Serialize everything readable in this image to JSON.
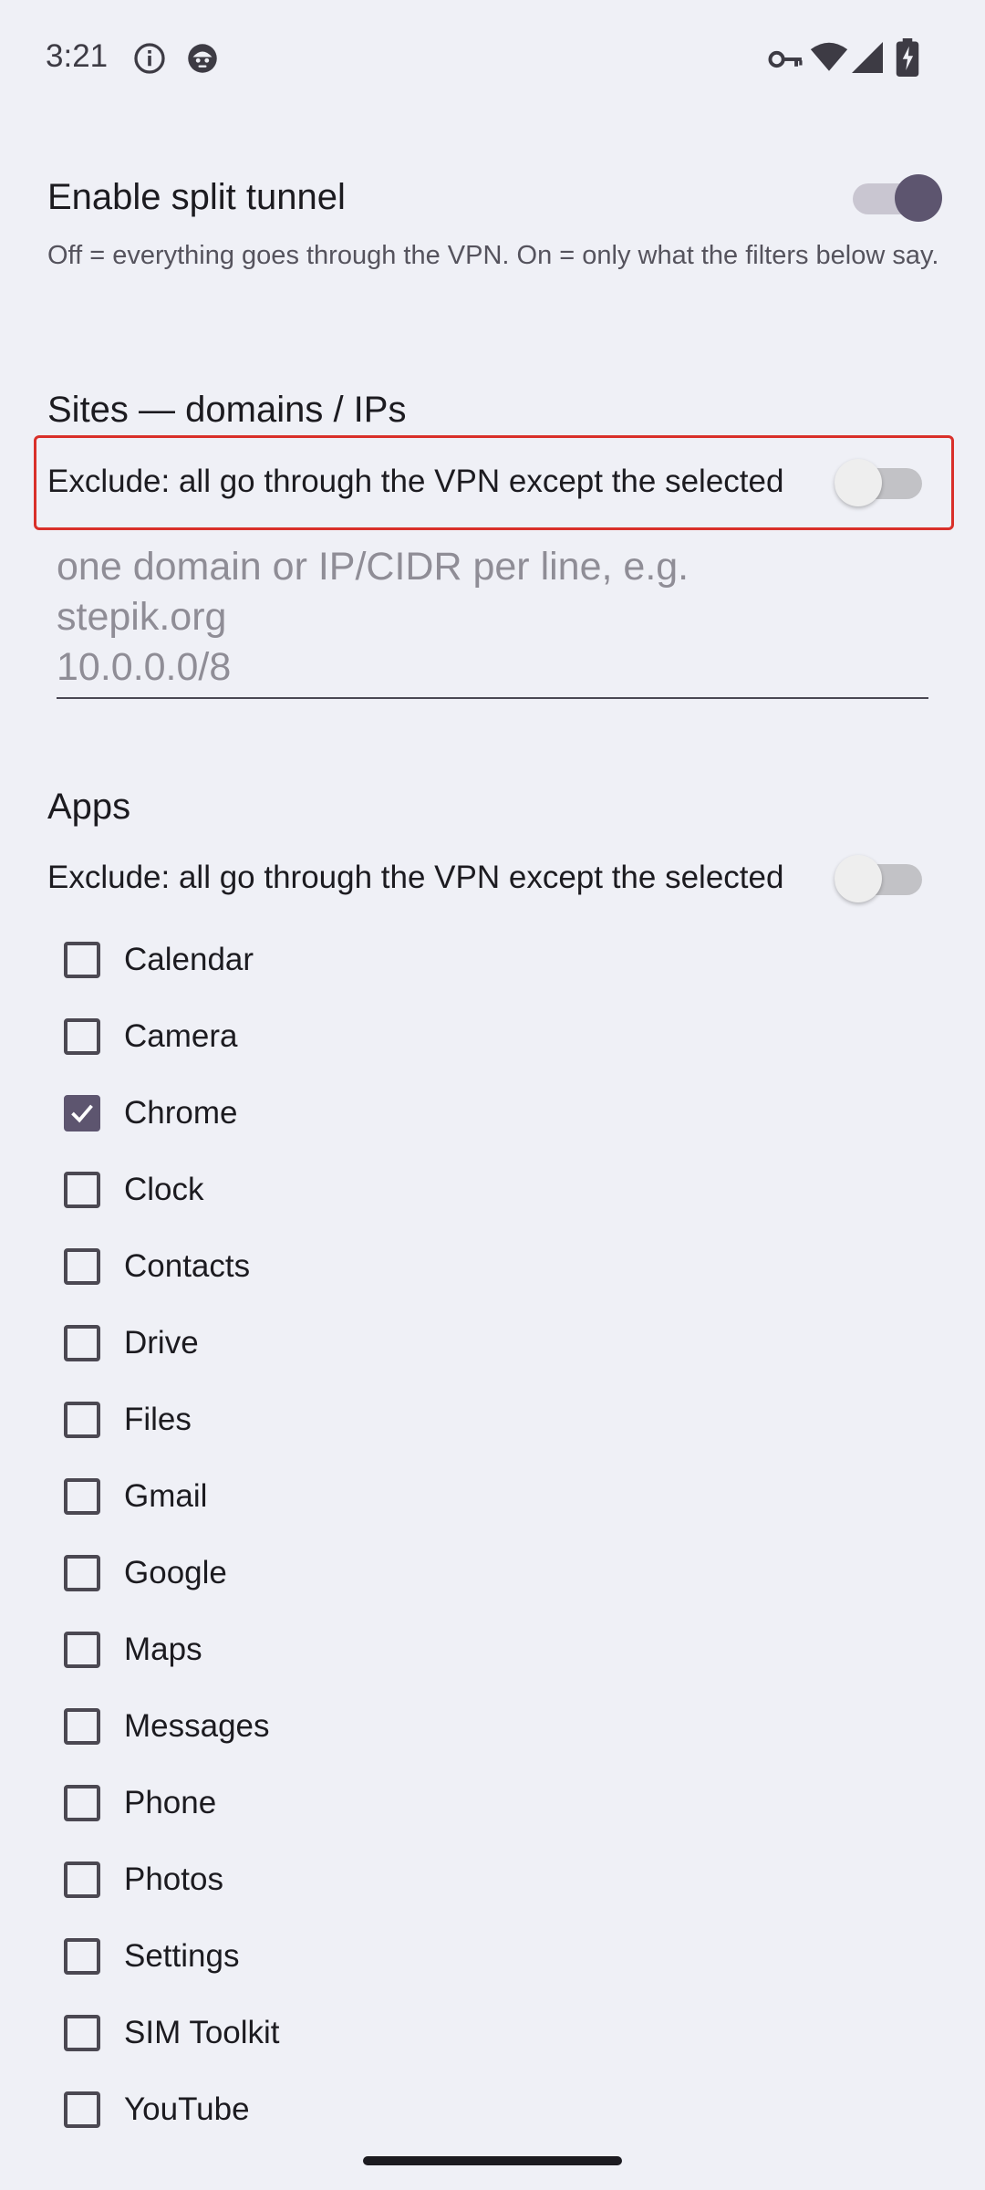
{
  "status_bar": {
    "time": "3:21",
    "icons": [
      "info-icon",
      "robot-icon",
      "vpn-key-icon",
      "wifi-icon",
      "signal-icon",
      "battery-charging-icon"
    ]
  },
  "split_tunnel": {
    "title": "Enable split tunnel",
    "description": "Off = everything goes through the VPN. On = only what the filters below say.",
    "enabled": true
  },
  "sites": {
    "heading": "Sites — domains / IPs",
    "exclude_label": "Exclude: all go through the VPN except the selected",
    "exclude_enabled": false,
    "input_value": "",
    "input_placeholder": "one domain or IP/CIDR per line, e.g.\nstepik.org\n10.0.0.0/8"
  },
  "apps": {
    "heading": "Apps",
    "exclude_label": "Exclude: all go through the VPN except the selected",
    "exclude_enabled": false,
    "items": [
      {
        "label": "Calendar",
        "checked": false
      },
      {
        "label": "Camera",
        "checked": false
      },
      {
        "label": "Chrome",
        "checked": true
      },
      {
        "label": "Clock",
        "checked": false
      },
      {
        "label": "Contacts",
        "checked": false
      },
      {
        "label": "Drive",
        "checked": false
      },
      {
        "label": "Files",
        "checked": false
      },
      {
        "label": "Gmail",
        "checked": false
      },
      {
        "label": "Google",
        "checked": false
      },
      {
        "label": "Maps",
        "checked": false
      },
      {
        "label": "Messages",
        "checked": false
      },
      {
        "label": "Phone",
        "checked": false
      },
      {
        "label": "Photos",
        "checked": false
      },
      {
        "label": "Settings",
        "checked": false
      },
      {
        "label": "SIM Toolkit",
        "checked": false
      },
      {
        "label": "YouTube",
        "checked": false
      }
    ]
  },
  "colors": {
    "background": "#eff0f6",
    "accent": "#5d556f",
    "highlight_border": "#d9302a"
  }
}
